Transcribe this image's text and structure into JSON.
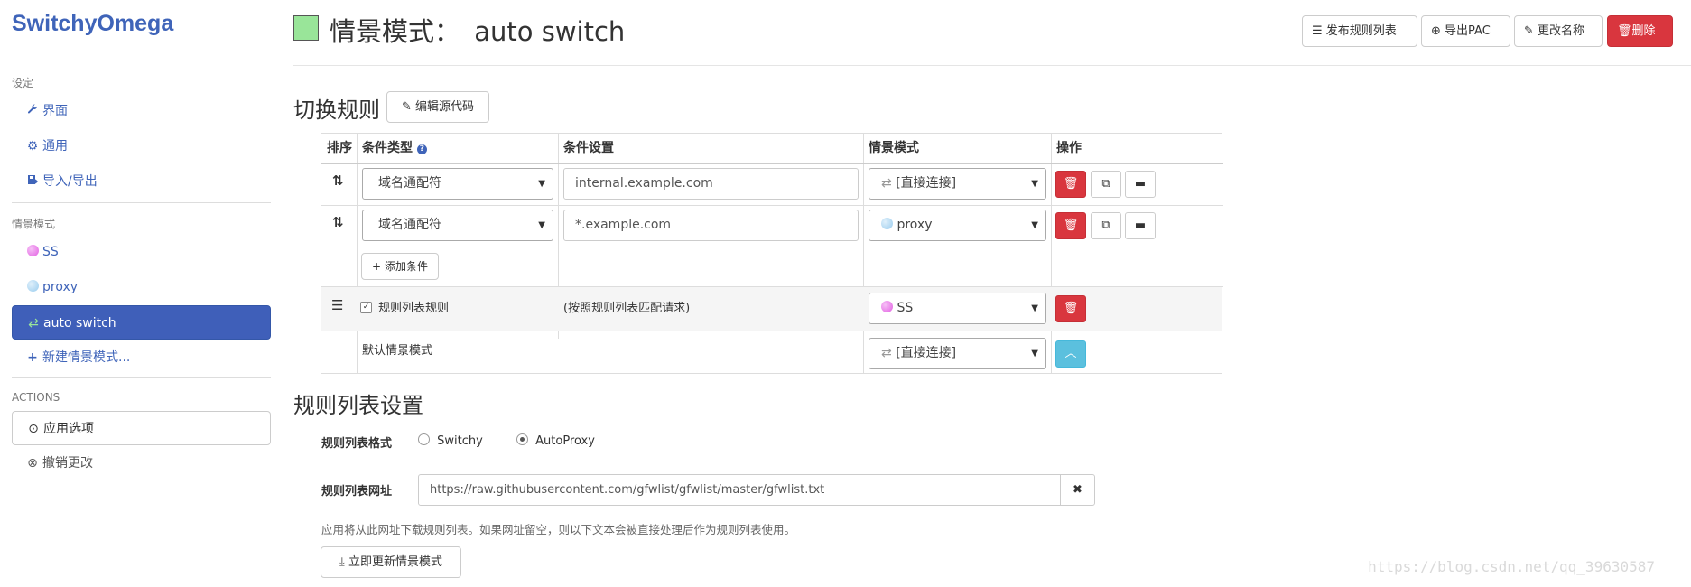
{
  "app": {
    "brand": "SwitchyOmega"
  },
  "sidebar": {
    "settings_header": "设定",
    "settings_items": [
      {
        "icon": "wrench-icon",
        "label": "界面"
      },
      {
        "icon": "gear-icon",
        "label": "通用"
      },
      {
        "icon": "import-export-icon",
        "label": "导入/导出"
      }
    ],
    "profiles_header": "情景模式",
    "profiles": [
      {
        "icon": "globe-icon",
        "label": "SS",
        "color": "#e25fe2"
      },
      {
        "icon": "globe-icon",
        "label": "proxy",
        "color": "#99ccee"
      },
      {
        "icon": "switch-icon",
        "label": "auto switch",
        "active": true
      }
    ],
    "new_profile": "新建情景模式...",
    "actions_header": "ACTIONS",
    "apply": "应用选项",
    "discard": "撤销更改"
  },
  "header": {
    "title_prefix": "情景模式：",
    "title_name": "auto switch",
    "swatch_color": "#99e599",
    "buttons": {
      "publish": "发布规则列表",
      "export_pac": "导出PAC",
      "rename": "更改名称",
      "delete": "删除"
    }
  },
  "switch_rules": {
    "title": "切换规则",
    "edit_source": "编辑源代码",
    "columns": {
      "sort": "排序",
      "condition_type": "条件类型",
      "condition": "条件设置",
      "profile": "情景模式",
      "actions": "操作"
    },
    "rules": [
      {
        "condition_type": "域名通配符",
        "condition": "internal.example.com",
        "profile": "[直接连接]",
        "profile_icon": "direct-icon"
      },
      {
        "condition_type": "域名通配符",
        "condition": "*.example.com",
        "profile": "proxy",
        "profile_icon": "globe-icon"
      }
    ],
    "add_condition": "添加条件",
    "rule_list_row": {
      "enabled": true,
      "label": "规则列表规则",
      "description": "(按照规则列表匹配请求)",
      "profile": "SS"
    },
    "default_row": {
      "label": "默认情景模式",
      "profile": "[直接连接]"
    }
  },
  "rule_list": {
    "title": "规则列表设置",
    "format_label": "规则列表格式",
    "formats": [
      {
        "label": "Switchy",
        "selected": false
      },
      {
        "label": "AutoProxy",
        "selected": true
      }
    ],
    "url_label": "规则列表网址",
    "url_value": "https://raw.githubusercontent.com/gfwlist/gfwlist/master/gfwlist.txt",
    "help": "应用将从此网址下载规则列表。如果网址留空，则以下文本会被直接处理后作为规则列表使用。",
    "update_now": "立即更新情景模式"
  },
  "watermark": "https://blog.csdn.net/qq_39630587"
}
